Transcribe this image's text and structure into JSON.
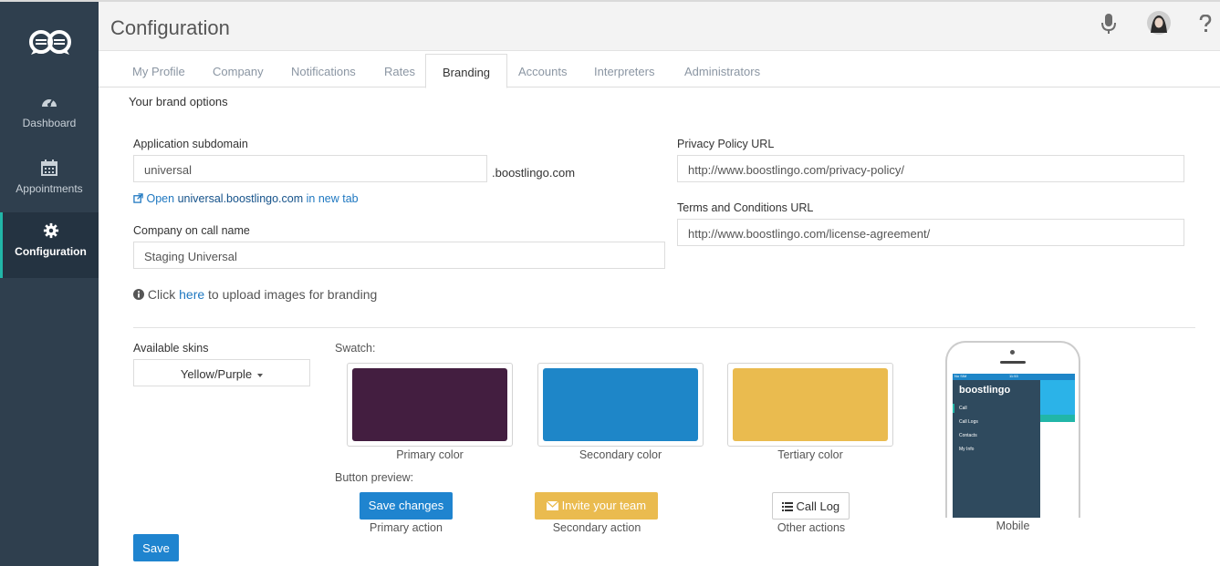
{
  "header": {
    "title": "Configuration"
  },
  "sidebar": {
    "items": [
      {
        "label": "Dashboard",
        "icon": "dashboard-icon"
      },
      {
        "label": "Appointments",
        "icon": "calendar-icon"
      },
      {
        "label": "Configuration",
        "icon": "gear-icon",
        "active": true
      }
    ]
  },
  "tabs": [
    "My Profile",
    "Company",
    "Notifications",
    "Rates",
    "Branding",
    "Accounts",
    "Interpreters",
    "Administrators"
  ],
  "active_tab": "Branding",
  "section_title": "Your brand options",
  "form": {
    "subdomain_label": "Application subdomain",
    "subdomain_value": "universal",
    "subdomain_suffix": ".boostlingo.com",
    "open_prefix": "Open",
    "open_link": "universal.boostlingo.com",
    "open_suffix": "in new tab",
    "company_label": "Company on call name",
    "company_value": "Staging Universal",
    "privacy_label": "Privacy Policy URL",
    "privacy_value": "http://www.boostlingo.com/privacy-policy/",
    "terms_label": "Terms and Conditions URL",
    "terms_value": "http://www.boostlingo.com/license-agreement/",
    "upload_prefix": "Click",
    "upload_link": "here",
    "upload_suffix": "to upload images for branding"
  },
  "skins": {
    "label": "Available skins",
    "selected": "Yellow/Purple"
  },
  "swatch": {
    "label": "Swatch:",
    "colors": [
      {
        "caption": "Primary color",
        "hex": "#431e40"
      },
      {
        "caption": "Secondary color",
        "hex": "#1e86c8"
      },
      {
        "caption": "Tertiary color",
        "hex": "#eabb4f"
      }
    ]
  },
  "preview": {
    "label": "Button preview:",
    "primary_btn": "Save changes",
    "primary_caption": "Primary action",
    "secondary_btn": "Invite your team",
    "secondary_caption": "Secondary action",
    "other_btn": "Call Log",
    "other_caption": "Other actions"
  },
  "mobile": {
    "caption": "Mobile",
    "brand": "boostlingo",
    "carrier": "No SIM",
    "time": "11:53",
    "menu": [
      "Call",
      "Call Logs",
      "Contacts",
      "My Info"
    ]
  },
  "save_label": "Save"
}
